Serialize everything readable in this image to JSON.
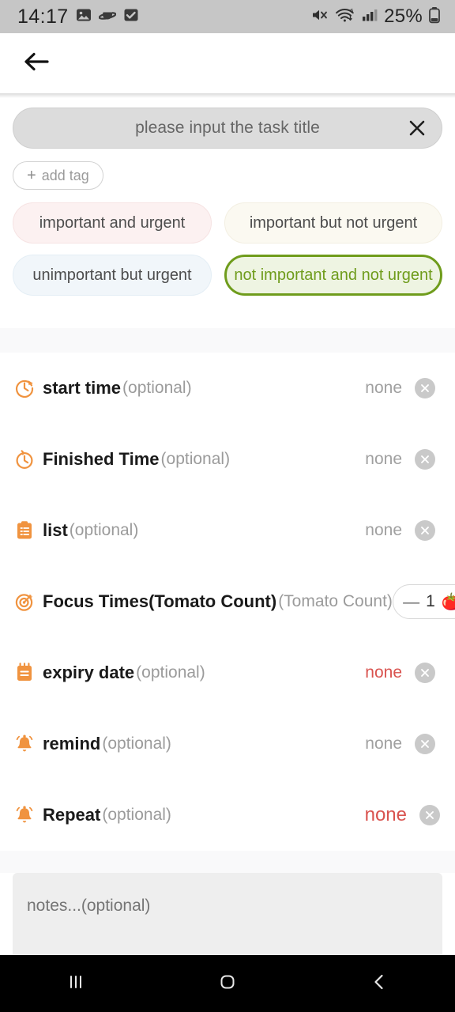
{
  "status_bar": {
    "time": "14:17",
    "battery_percent": "25%",
    "left_icons": [
      "image-icon",
      "planet-icon",
      "checkbox-icon"
    ],
    "right_icons": [
      "mute-icon",
      "wifi-icon",
      "signal-icon",
      "battery-icon"
    ]
  },
  "appbar": {
    "back_icon": "back-arrow-icon"
  },
  "title_input": {
    "placeholder": "please input the task title",
    "value": "",
    "clear_icon": "close-icon"
  },
  "tag": {
    "add_label": "add tag",
    "plus": "+"
  },
  "quadrants": [
    {
      "label": "important and urgent",
      "selected": false,
      "color": "#fcf1f1"
    },
    {
      "label": "important but not urgent",
      "selected": false,
      "color": "#fbf9f1"
    },
    {
      "label": "unimportant but urgent",
      "selected": false,
      "color": "#f1f6fa"
    },
    {
      "label": "not important and not urgent",
      "selected": true,
      "color": "#eef4e2",
      "accent": "#6f9c1c"
    }
  ],
  "rows": [
    {
      "icon": "clock-refresh-icon",
      "label": "start time",
      "sub": "(optional)",
      "value": "none",
      "value_color": "#a0a0a0"
    },
    {
      "icon": "timer-icon",
      "label": "Finished Time",
      "sub": "(optional)",
      "value": "none",
      "value_color": "#a0a0a0"
    },
    {
      "icon": "clipboard-list-icon",
      "label": "list",
      "sub": "(optional)",
      "value": "none",
      "value_color": "#a0a0a0"
    },
    {
      "icon": "target-icon",
      "label": "Focus Times(Tomato Count)",
      "sub": "(Tomato Count)",
      "value": "",
      "stepper": {
        "minus": "—",
        "count": "1",
        "tomato": "🍅"
      }
    },
    {
      "icon": "calendar-icon",
      "label": "expiry date",
      "sub": "(optional)",
      "value": "none",
      "value_color": "#d9534f"
    },
    {
      "icon": "bell-icon",
      "label": "remind",
      "sub": "(optional)",
      "value": "none",
      "value_color": "#a0a0a0"
    },
    {
      "icon": "bell-icon",
      "label": "Repeat",
      "sub": "(optional)",
      "value": "none",
      "value_color": "#d9534f"
    }
  ],
  "notes": {
    "placeholder": "notes...(optional)",
    "value": ""
  },
  "nav_bar": {
    "recents_icon": "recents-icon",
    "home_icon": "home-icon",
    "back_icon": "nav-back-icon"
  },
  "theme": {
    "accent_orange": "#f08d3c",
    "selected_green": "#6f9c1c",
    "danger_red": "#d9534f"
  }
}
